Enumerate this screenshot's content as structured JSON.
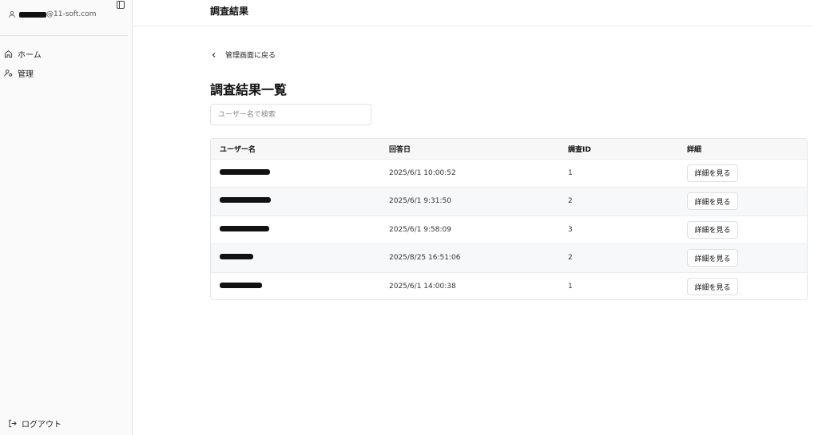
{
  "sidebar": {
    "user_email_suffix": "@11-soft.com",
    "nav": [
      {
        "label": "ホーム",
        "icon": "home-icon"
      },
      {
        "label": "管理",
        "icon": "user-settings-icon"
      }
    ],
    "logout_label": "ログアウト"
  },
  "header": {
    "title": "調査結果"
  },
  "main": {
    "back_label": "管理画面に戻る",
    "page_title": "調査結果一覧",
    "search_placeholder": "ユーザー名で検索"
  },
  "table": {
    "columns": [
      "ユーザー名",
      "回答日",
      "調査ID",
      "詳細"
    ],
    "rows": [
      {
        "username": "",
        "date": "2025/6/1 10:00:52",
        "survey_id": "1",
        "action": "詳細を見る"
      },
      {
        "username": "",
        "date": "2025/6/1 9:31:50",
        "survey_id": "2",
        "action": "詳細を見る"
      },
      {
        "username": "",
        "date": "2025/6/1 9:58:09",
        "survey_id": "3",
        "action": "詳細を見る"
      },
      {
        "username": "",
        "date": "2025/8/25 16:51:06",
        "survey_id": "2",
        "action": "詳細を見る"
      },
      {
        "username": "",
        "date": "2025/6/1 14:00:38",
        "survey_id": "1",
        "action": "詳細を見る"
      }
    ]
  }
}
